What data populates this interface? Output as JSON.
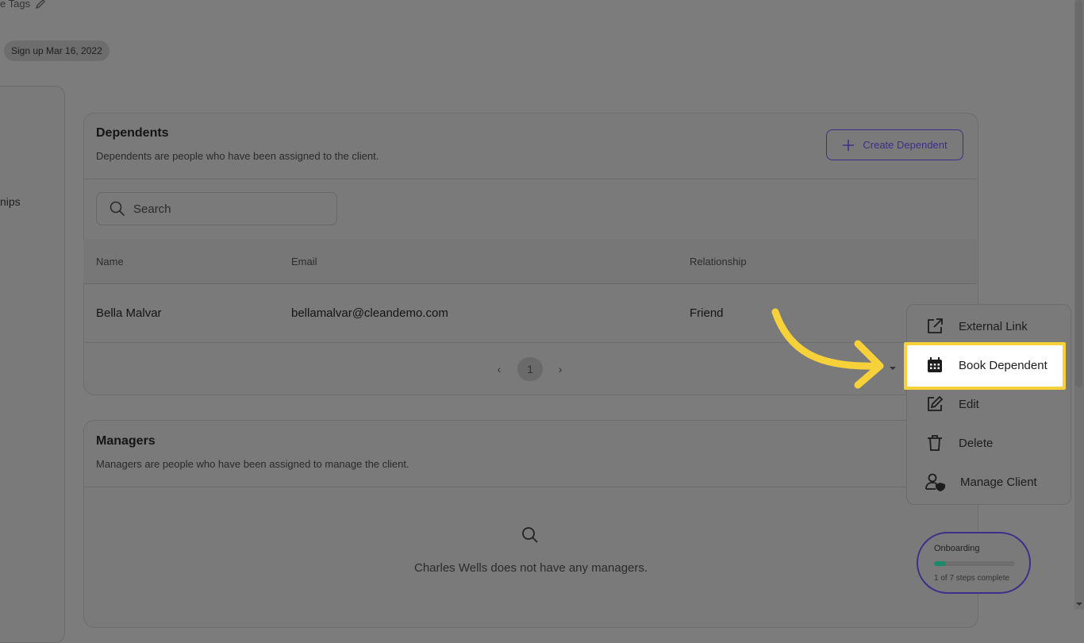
{
  "header": {
    "tags_label": "e Tags",
    "signup_chip": "Sign up Mar 16, 2022",
    "left_partial": "nips"
  },
  "dependents": {
    "title": "Dependents",
    "subtitle": "Dependents are people who have been assigned to the client.",
    "create_button": "Create Dependent",
    "search_placeholder": "Search",
    "columns": [
      "Name",
      "Email",
      "Relationship"
    ],
    "rows": [
      {
        "name": "Bella Malvar",
        "email": "bellamalvar@cleandemo.com",
        "relationship": "Friend"
      }
    ],
    "pagination": {
      "prev": "‹",
      "current": "1",
      "next": "›"
    }
  },
  "managers": {
    "title": "Managers",
    "subtitle": "Managers are people who have been assigned to manage the client.",
    "empty_text": "Charles Wells does not have any managers."
  },
  "action_menu": {
    "items": [
      {
        "label": "External Link",
        "icon": "external-link-icon"
      },
      {
        "label": "Book Dependent",
        "icon": "calendar-icon"
      },
      {
        "label": "Edit",
        "icon": "edit-icon"
      },
      {
        "label": "Delete",
        "icon": "trash-icon"
      },
      {
        "label": "Manage Client",
        "icon": "user-shield-icon"
      }
    ]
  },
  "onboarding": {
    "title": "Onboarding",
    "progress": 0.143,
    "status": "1 of 7 steps complete"
  },
  "colors": {
    "accent": "#3b2f86",
    "highlight": "#f7d13a",
    "progress": "#1b8a6b"
  }
}
